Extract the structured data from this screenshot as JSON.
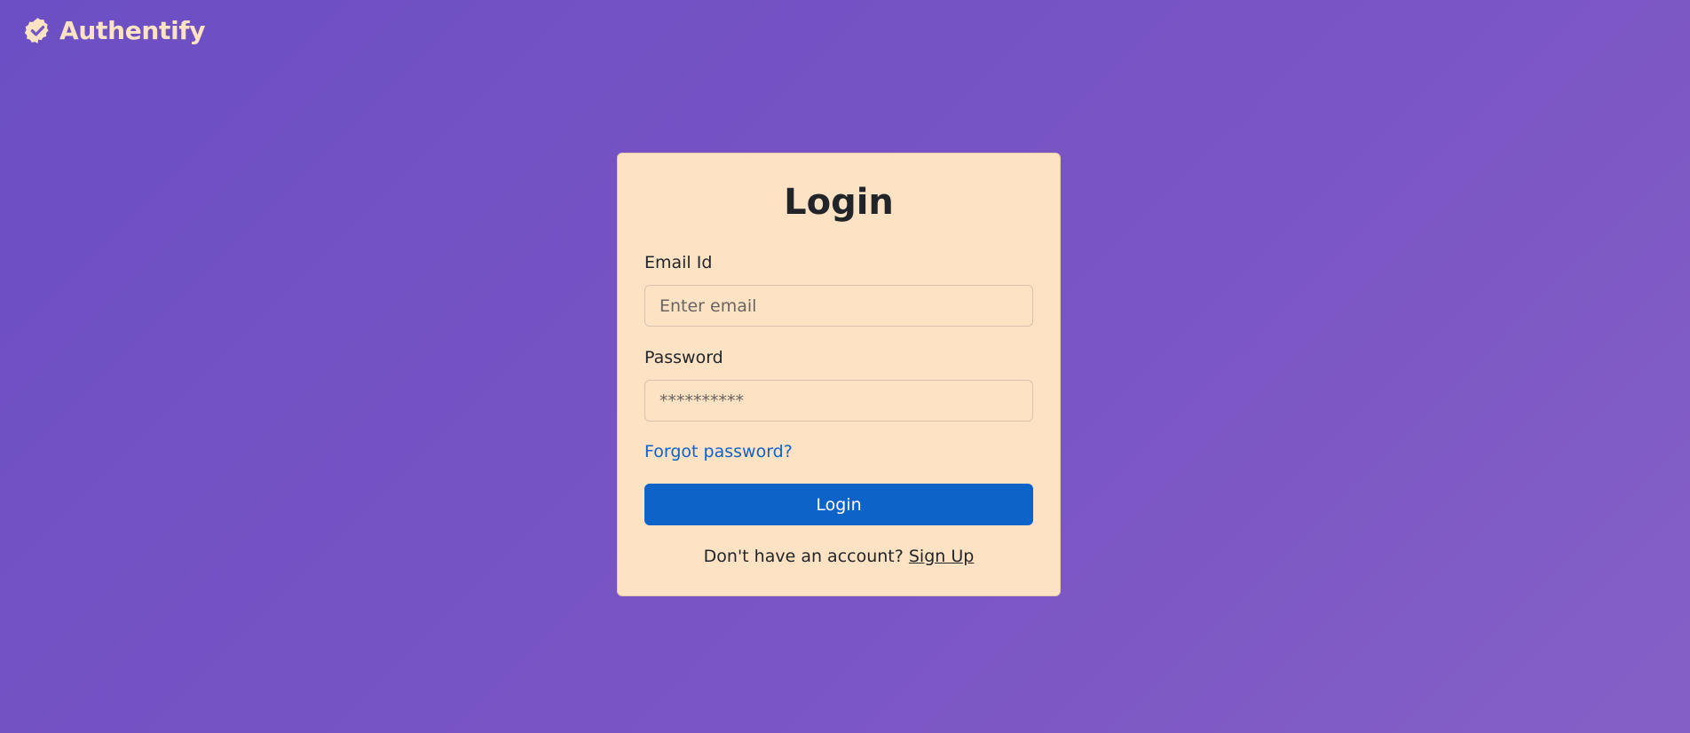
{
  "brand": {
    "name": "Authentify",
    "icon": "verified-badge-icon",
    "color": "#fde3c4"
  },
  "login_form": {
    "title": "Login",
    "email_label": "Email Id",
    "email_placeholder": "Enter email",
    "password_label": "Password",
    "password_placeholder": "**********",
    "forgot_password": "Forgot password?",
    "submit_label": "Login",
    "signup_prompt": "Don't have an account?",
    "signup_link": "Sign Up"
  },
  "colors": {
    "background_start": "#6c4fc4",
    "background_end": "#8460c6",
    "card": "#fee2c4",
    "accent": "#0d63c8"
  }
}
